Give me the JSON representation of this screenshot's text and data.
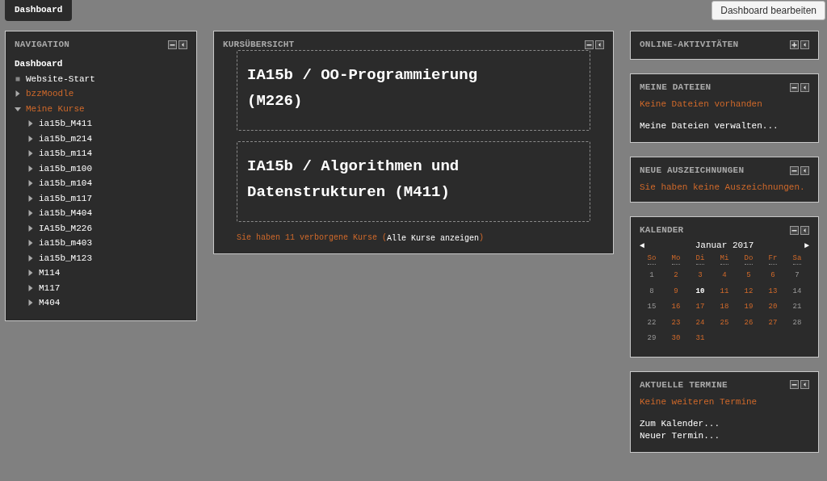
{
  "header": {
    "tab": {
      "label": "Dashboard",
      "selected": true
    },
    "edit_button": "Dashboard bearbeiten"
  },
  "navigation": {
    "title": "NAVIGATION",
    "collapsed": false,
    "items": [
      {
        "label": "Dashboard",
        "kind": "root"
      },
      {
        "label": "Website-Start",
        "kind": "leaf"
      },
      {
        "label": "bzzMoodle",
        "kind": "branch",
        "expanded": false
      },
      {
        "label": "Meine Kurse",
        "kind": "branch",
        "expanded": true,
        "children": [
          {
            "label": "ia15b_M411",
            "kind": "course",
            "expanded": false
          },
          {
            "label": "ia15b_m214",
            "kind": "course",
            "expanded": false
          },
          {
            "label": "ia15b_m114",
            "kind": "course",
            "expanded": false
          },
          {
            "label": "ia15b_m100",
            "kind": "course",
            "expanded": false
          },
          {
            "label": "ia15b_m104",
            "kind": "course",
            "expanded": false
          },
          {
            "label": "ia15b_m117",
            "kind": "course",
            "expanded": false
          },
          {
            "label": "ia15b_M404",
            "kind": "course",
            "expanded": false
          },
          {
            "label": "IA15b_M226",
            "kind": "course",
            "expanded": false
          },
          {
            "label": "ia15b_m403",
            "kind": "course",
            "expanded": false
          },
          {
            "label": "ia15b_M123",
            "kind": "course",
            "expanded": false
          },
          {
            "label": "M114",
            "kind": "course",
            "expanded": false
          },
          {
            "label": "M117",
            "kind": "course",
            "expanded": false
          },
          {
            "label": "M404",
            "kind": "course",
            "expanded": false
          }
        ]
      }
    ]
  },
  "course_overview": {
    "title": "KURSÜBERSICHT",
    "collapsed": false,
    "courses": [
      "IA15b / OO-Programmierung (M226)",
      "IA15b / Algorithmen und Datenstrukturen (M411)"
    ],
    "hidden_note": "Sie haben 11 verborgene Kurse (",
    "show_all_link": "Alle Kurse anzeigen",
    "hidden_note_end": ")"
  },
  "online_activities": {
    "title": "ONLINE-AKTIVITÄTEN",
    "collapsed": true
  },
  "my_files": {
    "title": "MEINE DATEIEN",
    "collapsed": false,
    "notice": "Keine Dateien vorhanden",
    "links": [
      "Meine Dateien verwalten..."
    ]
  },
  "badges": {
    "title": "NEUE AUSZEICHNUNGEN",
    "collapsed": false,
    "notice": "Sie haben keine Auszeichnungen."
  },
  "calendar": {
    "title": "KALENDER",
    "collapsed": false,
    "prev": "◄",
    "month": "Januar 2017",
    "next": "►",
    "weekdays": [
      "So",
      "Mo",
      "Di",
      "Mi",
      "Do",
      "Fr",
      "Sa"
    ],
    "weeks": [
      [
        {
          "day": "1",
          "kind": "weekend"
        },
        {
          "day": "2",
          "kind": "weekday"
        },
        {
          "day": "3",
          "kind": "weekday"
        },
        {
          "day": "4",
          "kind": "weekday"
        },
        {
          "day": "5",
          "kind": "weekday"
        },
        {
          "day": "6",
          "kind": "weekday"
        },
        {
          "day": "7",
          "kind": "weekend"
        }
      ],
      [
        {
          "day": "8",
          "kind": "weekend"
        },
        {
          "day": "9",
          "kind": "weekday"
        },
        {
          "day": "10",
          "kind": "today"
        },
        {
          "day": "11",
          "kind": "weekday"
        },
        {
          "day": "12",
          "kind": "weekday"
        },
        {
          "day": "13",
          "kind": "weekday"
        },
        {
          "day": "14",
          "kind": "weekend"
        }
      ],
      [
        {
          "day": "15",
          "kind": "weekend"
        },
        {
          "day": "16",
          "kind": "weekday"
        },
        {
          "day": "17",
          "kind": "weekday"
        },
        {
          "day": "18",
          "kind": "weekday"
        },
        {
          "day": "19",
          "kind": "weekday"
        },
        {
          "day": "20",
          "kind": "weekday"
        },
        {
          "day": "21",
          "kind": "weekend"
        }
      ],
      [
        {
          "day": "22",
          "kind": "weekend"
        },
        {
          "day": "23",
          "kind": "weekday"
        },
        {
          "day": "24",
          "kind": "weekday"
        },
        {
          "day": "25",
          "kind": "weekday"
        },
        {
          "day": "26",
          "kind": "weekday"
        },
        {
          "day": "27",
          "kind": "weekday"
        },
        {
          "day": "28",
          "kind": "weekend"
        }
      ],
      [
        {
          "day": "29",
          "kind": "weekend"
        },
        {
          "day": "30",
          "kind": "weekday"
        },
        {
          "day": "31",
          "kind": "weekday"
        }
      ]
    ]
  },
  "upcoming": {
    "title": "AKTUELLE TERMINE",
    "collapsed": false,
    "notice": "Keine weiteren Termine",
    "links": [
      "Zum Kalender...",
      "Neuer Termin..."
    ]
  }
}
